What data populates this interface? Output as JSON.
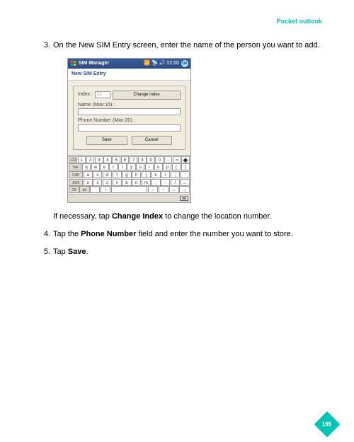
{
  "header": "Pocket outlook",
  "steps": {
    "s3": {
      "num": "3.",
      "text": "On the New SIM Entry screen, enter the name of the person you want to add.",
      "cont_before": "If necessary, tap ",
      "cont_bold": "Change Index",
      "cont_after": " to change the location number."
    },
    "s4": {
      "num": "4.",
      "before": "Tap the ",
      "bold": "Phone Number",
      "after": " field and enter the number you want to store."
    },
    "s5": {
      "num": "5.",
      "before": "Tap ",
      "bold": "Save",
      "after": "."
    }
  },
  "phone": {
    "app_title": "SIM Manager",
    "time": "22:00",
    "ok": "ok",
    "subtitle": "New SIM Entry",
    "index_label": "Index :",
    "index_value": "22",
    "change_index_btn": "Change Index",
    "name_label": "Name (Max:16) :",
    "phone_label": "Phone Number (Max:20) :",
    "save_btn": "Save",
    "cancel_btn": "Cancel",
    "kbd": {
      "r1": [
        "123",
        "1",
        "2",
        "3",
        "4",
        "5",
        "6",
        "7",
        "8",
        "9",
        "0",
        "-",
        "=",
        "◆"
      ],
      "r2": [
        "Tab",
        "q",
        "w",
        "e",
        "r",
        "t",
        "y",
        "u",
        "i",
        "o",
        "p",
        "[",
        "]"
      ],
      "r3": [
        "CAP",
        "a",
        "s",
        "d",
        "f",
        "g",
        "h",
        "j",
        "k",
        "l",
        ";",
        "'"
      ],
      "r4": [
        "Shift",
        "z",
        "x",
        "c",
        "v",
        "b",
        "n",
        "m",
        ",",
        ".",
        "/",
        "←"
      ],
      "r5": [
        "Ctl",
        "áü",
        "`",
        "\\",
        " ",
        "↓",
        "↑",
        "←",
        "→"
      ]
    }
  },
  "page_number": "199"
}
